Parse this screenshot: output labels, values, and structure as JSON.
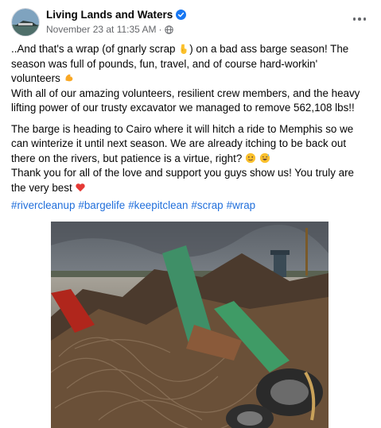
{
  "post": {
    "author": "Living Lands and Waters",
    "timestamp": "November 23 at 11:35 AM",
    "separator": "·",
    "paragraph1_line1": "..And that's a wrap (of gnarly scrap ",
    "paragraph1_line1b": ") on a bad ass barge season! The",
    "paragraph1_line2": "season was full of pounds, fun, travel, and of course hard-workin'",
    "paragraph1_line3": "volunteers ",
    "paragraph1_line4": "With all of our amazing volunteers, resilient crew members, and the heavy",
    "paragraph1_line5": "lifting power of our trusty excavator we managed to remove 562,108 lbs!!",
    "paragraph2_line1": "The barge is heading to Cairo where it will hitch a ride to Memphis so we",
    "paragraph2_line2": "can winterize it until next season. We are already itching to be back out",
    "paragraph2_line3": "there on the rivers, but patience is a virtue, right? ",
    "paragraph2_line4": "Thank you for all of the love and support you guys show us! You truly are",
    "paragraph2_line5": "the very best ",
    "hashtags": [
      "#rivercleanup",
      "#bargelife",
      "#keepitclean",
      "#scrap",
      "#wrap"
    ]
  },
  "icons": {
    "verified": "verified-badge-icon",
    "privacy": "globe-icon",
    "more": "more-options-icon",
    "emoji1": "pointing-down-hand-emoji",
    "emoji2": "flexed-biceps-emoji",
    "emoji3": "smiling-face-emoji",
    "emoji4": "grinning-sweat-emoji",
    "emoji5": "red-heart-emoji"
  },
  "colors": {
    "link": "#216fdb",
    "text": "#050505",
    "meta": "#65676b",
    "verified": "#1877f2"
  }
}
